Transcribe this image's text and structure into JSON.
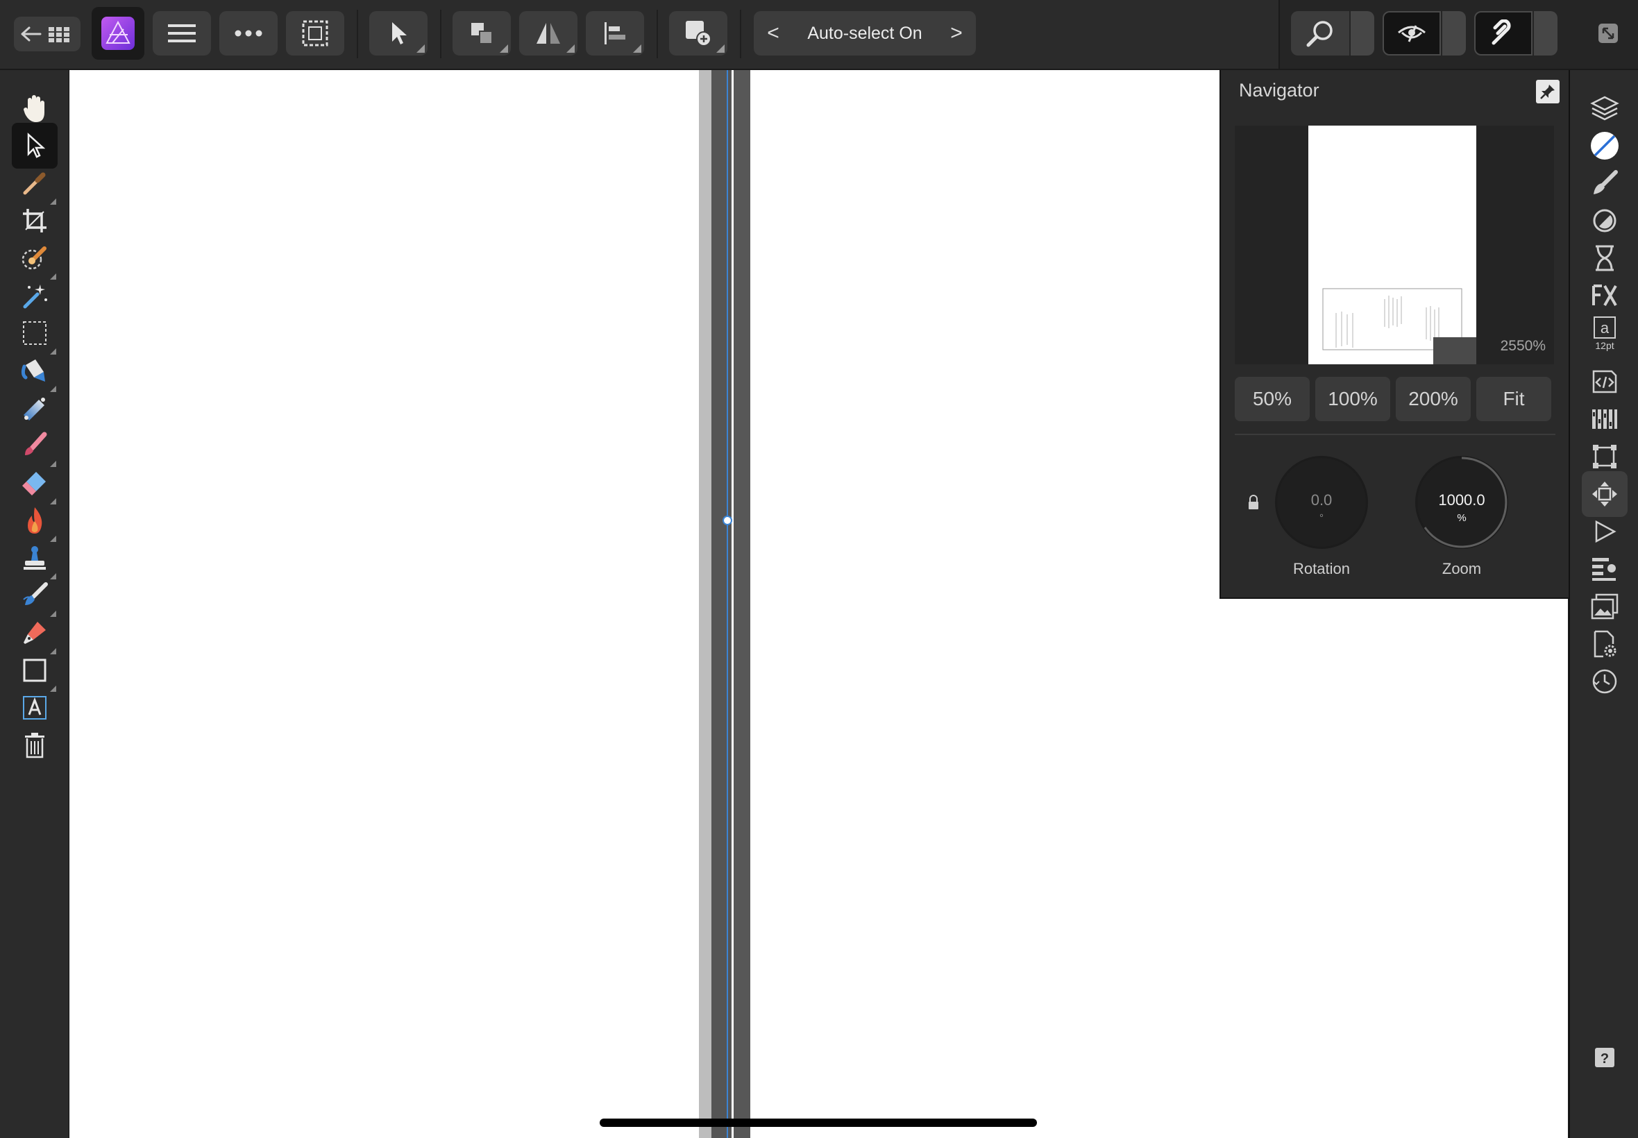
{
  "toolbar": {
    "context_toggle": "Auto-select On",
    "prev_arrow": "<",
    "next_arrow": ">"
  },
  "navigator": {
    "title": "Navigator",
    "preview_zoom": "2550%",
    "zoom_buttons": [
      "50%",
      "100%",
      "200%",
      "Fit"
    ],
    "rotation": {
      "value": "0.0",
      "unit": "°",
      "label": "Rotation"
    },
    "zoom": {
      "value": "1000.0",
      "unit": "%",
      "label": "Zoom"
    }
  },
  "studio": {
    "text_size": "12pt"
  },
  "colors": {
    "accent": "#3b84d4",
    "panel": "#2a2a2a",
    "toolbar": "#2b2b2b",
    "canvas": "#ffffff"
  }
}
